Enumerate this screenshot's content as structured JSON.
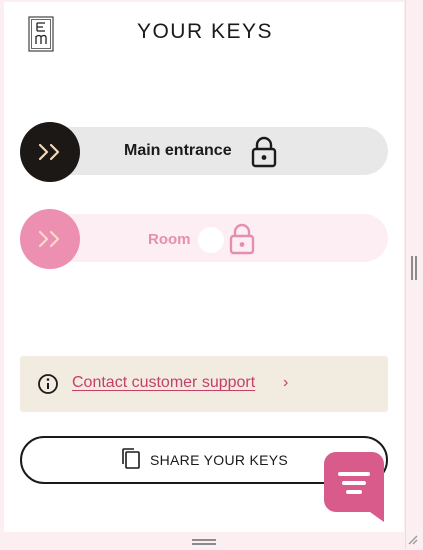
{
  "header": {
    "title": "YOUR KEYS",
    "logo_letters": "E m"
  },
  "keys": [
    {
      "label": "Main entrance",
      "state": "enabled"
    },
    {
      "label": "Room",
      "state": "disabled"
    }
  ],
  "support": {
    "link_text": "Contact customer support",
    "chevron": "›"
  },
  "share": {
    "label": "SHARE YOUR KEYS"
  },
  "colors": {
    "accent_pink": "#ec8fb0",
    "dark_knob": "#1c1816",
    "support_bg": "#f2ebe0",
    "link": "#c4406a",
    "page_bg": "#fbeff2"
  }
}
